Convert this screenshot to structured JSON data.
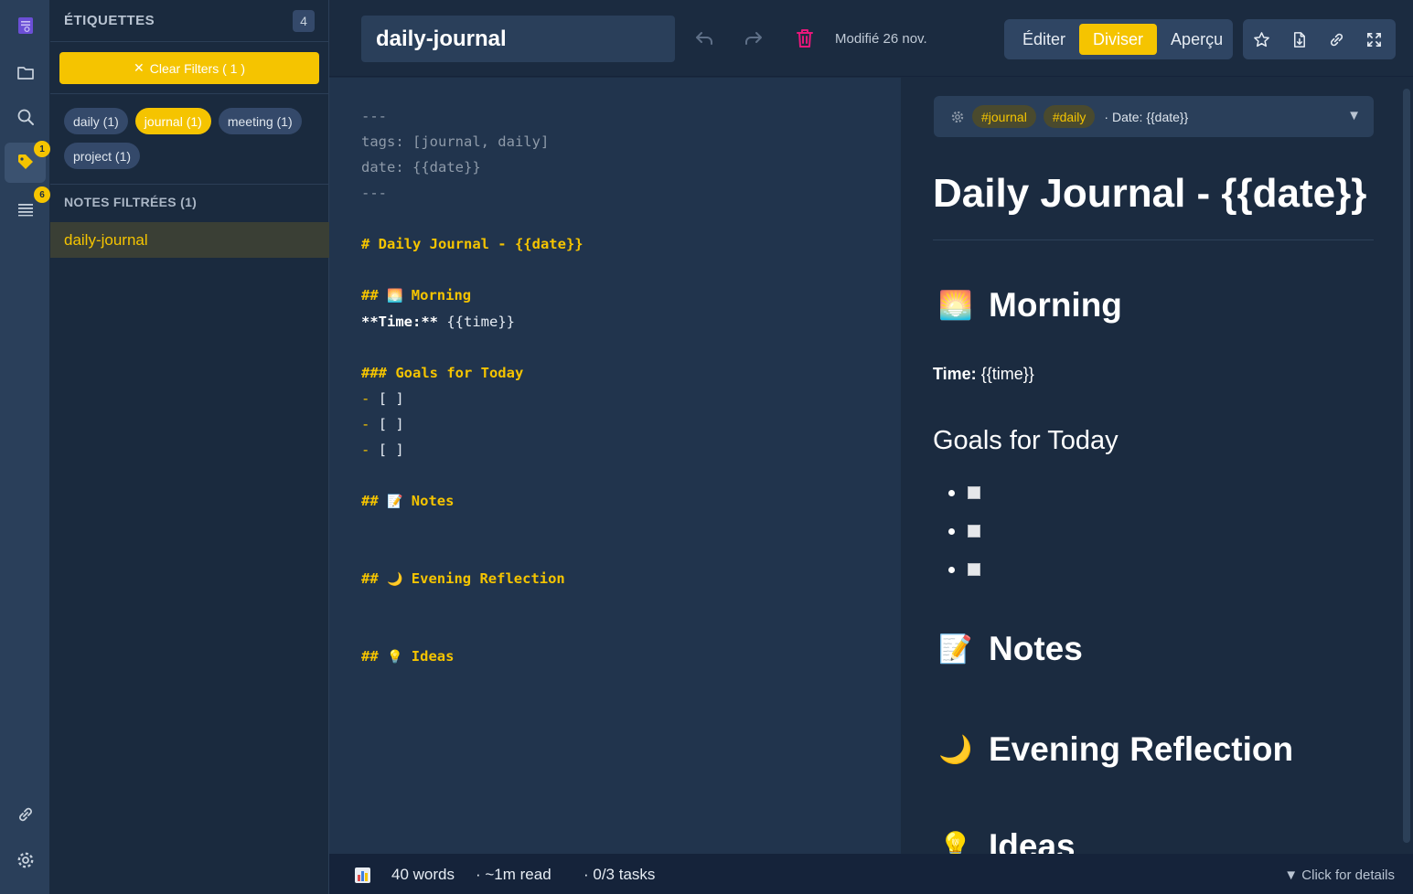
{
  "rail": {
    "tags_badge": "1",
    "list_badge": "6"
  },
  "panel": {
    "title": "ÉTIQUETTES",
    "count": "4",
    "clear_label": "Clear Filters ( 1 )",
    "tags": [
      {
        "label": "daily (1)",
        "selected": false
      },
      {
        "label": "journal (1)",
        "selected": true
      },
      {
        "label": "meeting (1)",
        "selected": false
      },
      {
        "label": "project (1)",
        "selected": false
      }
    ],
    "filtered_title": "NOTES FILTRÉES (1)",
    "notes": [
      "daily-journal"
    ]
  },
  "topbar": {
    "title": "daily-journal",
    "modified": "Modifié 26 nov.",
    "modes": [
      "Éditer",
      "Diviser",
      "Aperçu"
    ],
    "active_mode": "Diviser"
  },
  "editor": {
    "lines": {
      "fm_open": "---",
      "fm_tags": "tags: [journal, daily]",
      "fm_date": "date: {{date}}",
      "fm_close": "---",
      "h1": "# Daily Journal - {{date}}",
      "h2_morning_prefix": "##",
      "h2_morning": "Morning",
      "time_key": "**Time:**",
      "time_val": "{{time}}",
      "h3_goals": "### Goals for Today",
      "task_dash": "-",
      "task_box": "[ ]",
      "h2_notes_prefix": "##",
      "h2_notes": "Notes",
      "h2_evening_prefix": "##",
      "h2_evening": "Evening Reflection",
      "h2_ideas_prefix": "##",
      "h2_ideas": "Ideas"
    }
  },
  "preview": {
    "frontmatter": {
      "tags": [
        "#journal",
        "#daily"
      ],
      "date": "· Date: {{date}}"
    },
    "h1": "Daily Journal - {{date}}",
    "morning": "Morning",
    "time_label": "Time:",
    "time_value": " {{time}}",
    "goals": "Goals for Today",
    "notes": "Notes",
    "evening": "Evening Reflection",
    "ideas": "Ideas"
  },
  "status": {
    "words": "40 words",
    "read": "·   ~1m read",
    "tasks": "· 0/3 tasks",
    "details": "▼ Click for details"
  },
  "colors": {
    "accent": "#f5c400",
    "delete": "#e8177a",
    "background": "#1b2b40"
  }
}
